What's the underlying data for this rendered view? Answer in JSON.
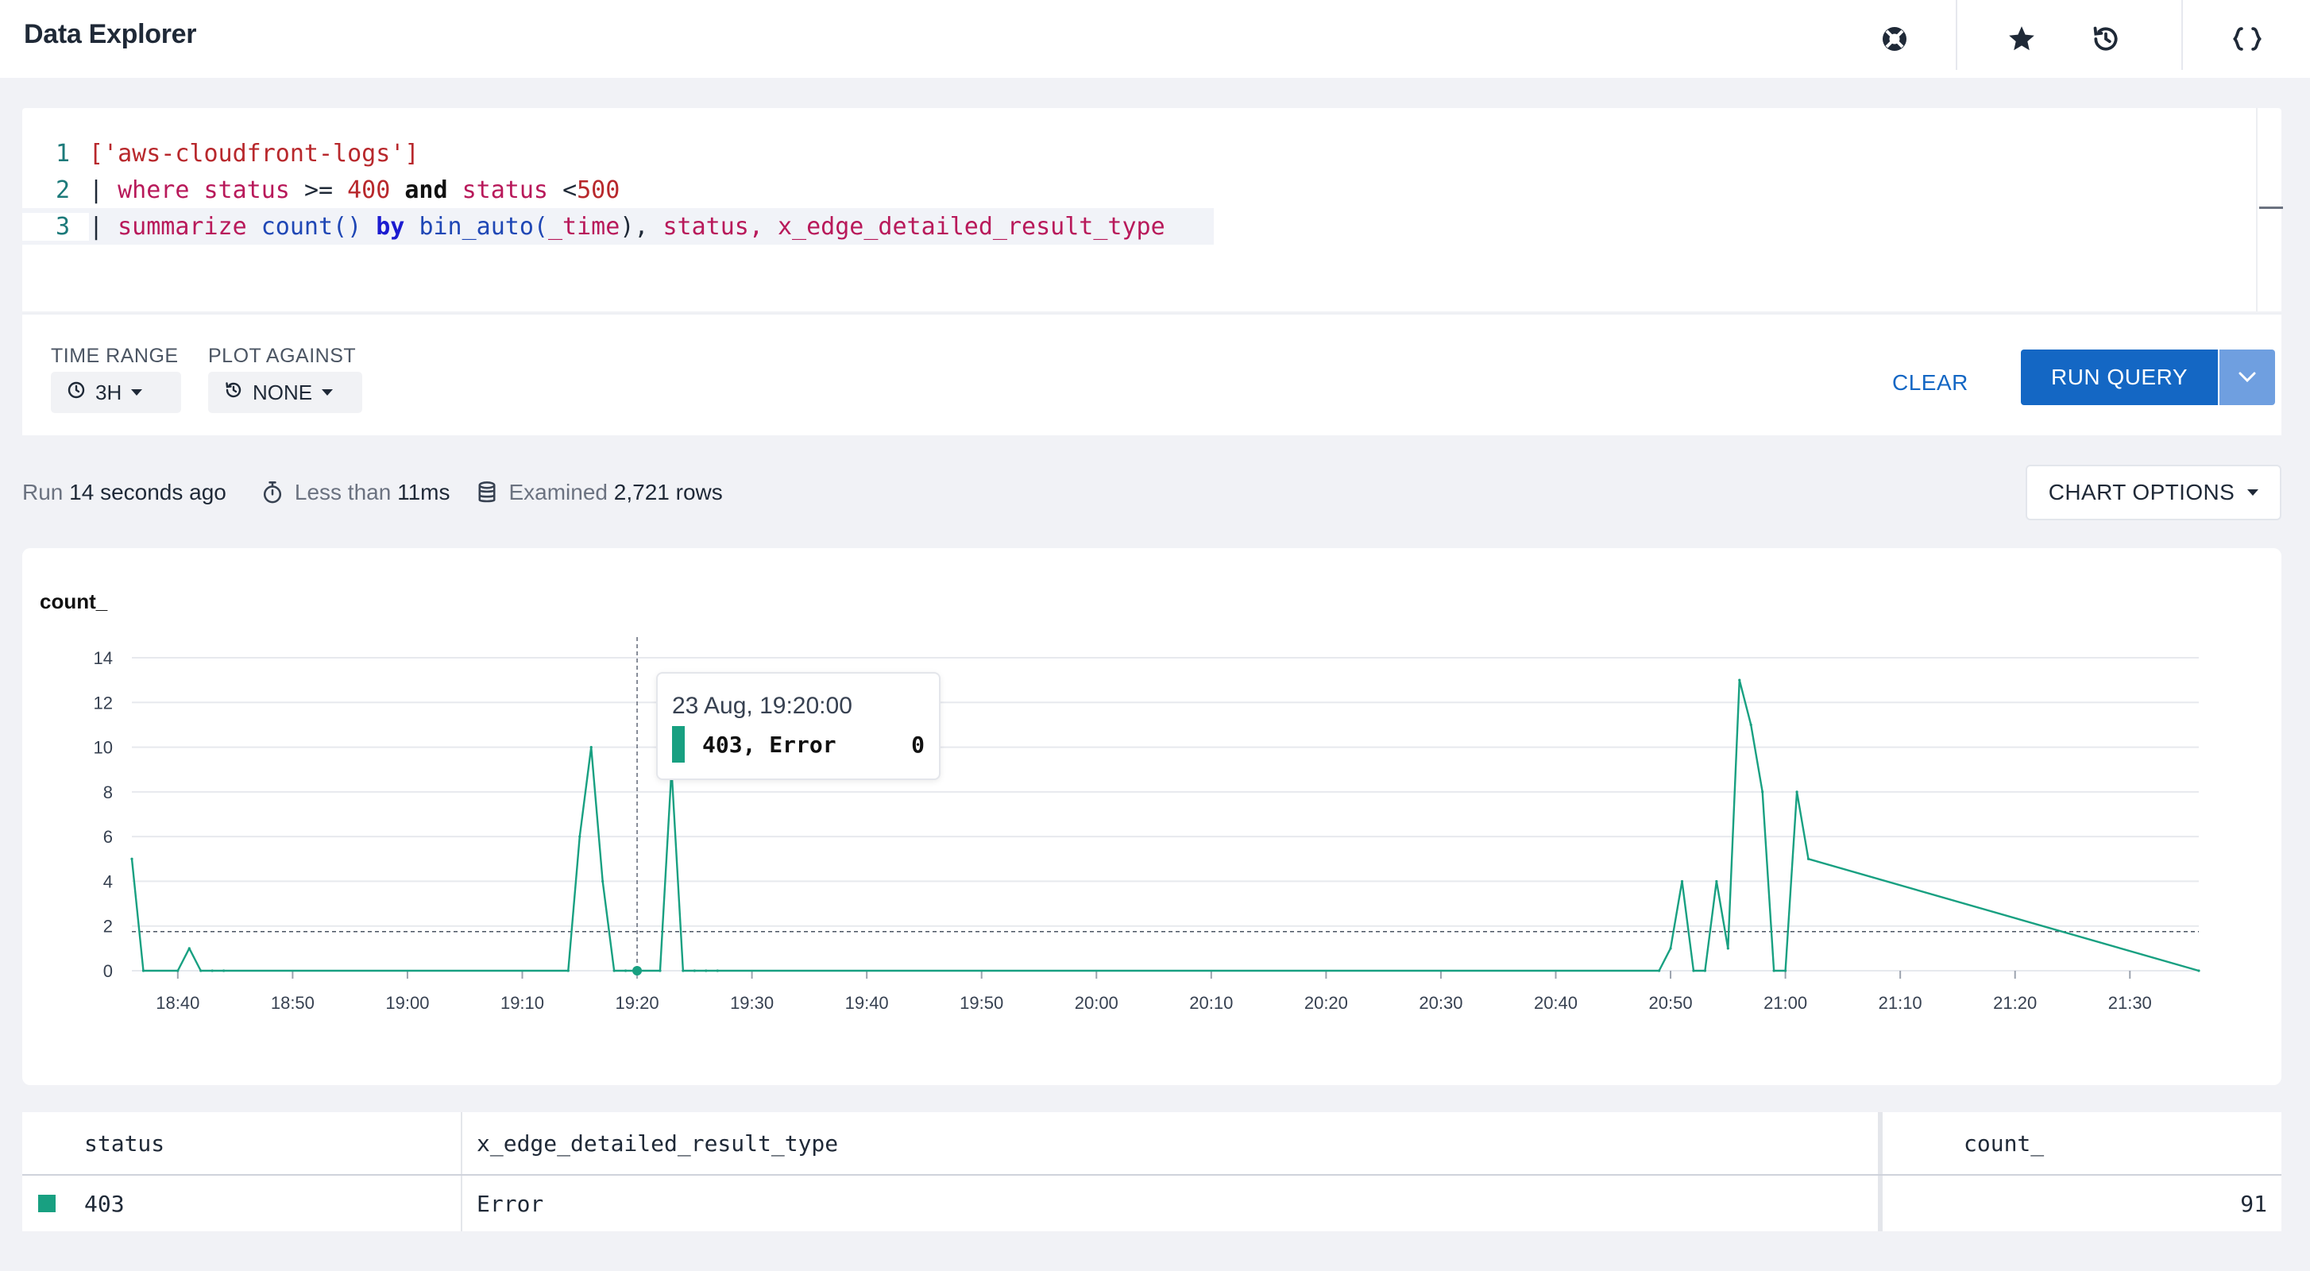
{
  "header": {
    "title": "Data Explorer",
    "icons": [
      "help-lifebuoy-icon",
      "star-icon",
      "history-icon",
      "code-braces-icon"
    ]
  },
  "editor": {
    "line_numbers": [
      "1",
      "2",
      "3"
    ],
    "line1": {
      "dataset": "['aws-cloudfront-logs']"
    },
    "line2": {
      "pipe": "| ",
      "kw_where": "where",
      "field1": "status",
      "op1": ">=",
      "num1": "400",
      "kw_and": "and",
      "field2": "status",
      "op2": "<",
      "num2": "500"
    },
    "line3": {
      "pipe": "| ",
      "kw_summarize": "summarize",
      "fn_count": "count()",
      "kw_by": "by",
      "fn_bin": "bin_auto(",
      "arg_time": "_time",
      "close": "),",
      "field_status": "status,",
      "field_edge": "x_edge_detailed_result_type"
    }
  },
  "controls": {
    "time_range_label": "TIME RANGE",
    "time_range_value": "3H",
    "plot_against_label": "PLOT AGAINST",
    "plot_against_value": "NONE",
    "clear_label": "CLEAR",
    "run_label": "RUN QUERY"
  },
  "stats": {
    "run_prefix": "Run",
    "run_value": "14 seconds ago",
    "duration_prefix": "Less than",
    "duration_value": "11ms",
    "examined_prefix": "Examined",
    "examined_value": "2,721 rows",
    "chart_options_label": "CHART OPTIONS"
  },
  "chart_data": {
    "type": "line",
    "ylabel": "count_",
    "ylim": [
      0,
      14
    ],
    "yticks": [
      0,
      2,
      4,
      6,
      8,
      10,
      12,
      14
    ],
    "xticks": [
      "18:40",
      "18:50",
      "19:00",
      "19:10",
      "19:20",
      "19:30",
      "19:40",
      "19:50",
      "20:00",
      "20:10",
      "20:20",
      "20:30",
      "20:40",
      "20:50",
      "21:00",
      "21:10",
      "21:20",
      "21:30"
    ],
    "xlim_minutes": [
      636,
      816
    ],
    "reference_line_y": 1.75,
    "series": [
      {
        "name": "403, Error",
        "color": "#18a081",
        "x": [
          636,
          637,
          640,
          641,
          642,
          643,
          644,
          674,
          675,
          676,
          677,
          678,
          679,
          680,
          682,
          683,
          684,
          685,
          686,
          687,
          769,
          770,
          771,
          772,
          773,
          774,
          775,
          776,
          777,
          778,
          779,
          780,
          781,
          782,
          816
        ],
        "y": [
          5,
          0,
          0,
          1,
          0,
          0,
          0,
          0,
          6,
          10,
          4,
          0,
          0,
          0,
          0,
          9,
          0,
          0,
          0,
          0,
          0,
          1,
          4,
          0,
          0,
          4,
          1,
          13,
          11,
          8,
          0,
          0,
          8,
          5,
          0
        ]
      }
    ],
    "tooltip": {
      "date": "23 Aug, 19:20:00",
      "series": "403, Error",
      "value": "0",
      "x_minute": 680
    }
  },
  "table": {
    "columns": [
      "status",
      "x_edge_detailed_result_type",
      "count_"
    ],
    "rows": [
      {
        "status": "403",
        "type": "Error",
        "count": "91"
      }
    ],
    "row_color": "#18a081"
  }
}
